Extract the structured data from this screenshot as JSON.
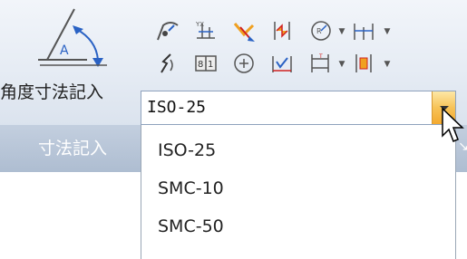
{
  "ribbon": {
    "angle_dimension": {
      "label": "角度寸法記入",
      "icon": "angle-dimension-icon"
    },
    "tool_icons": [
      "arc-dimension-icon",
      "ordinate-dimension-icon",
      "leader-dimension-icon",
      "break-dimension-icon",
      "radius-dimension-icon",
      "linear-dimension-icon",
      "jogged-dimension-icon",
      "dimension-table-icon",
      "center-mark-icon",
      "inspection-dimension-icon",
      "baseline-dimension-icon",
      "dimension-space-icon"
    ],
    "panel_title": "寸法記入"
  },
  "dimension_style": {
    "selected": "ISO-25",
    "options": [
      "ISO-25",
      "SMC-10",
      "SMC-50"
    ]
  }
}
